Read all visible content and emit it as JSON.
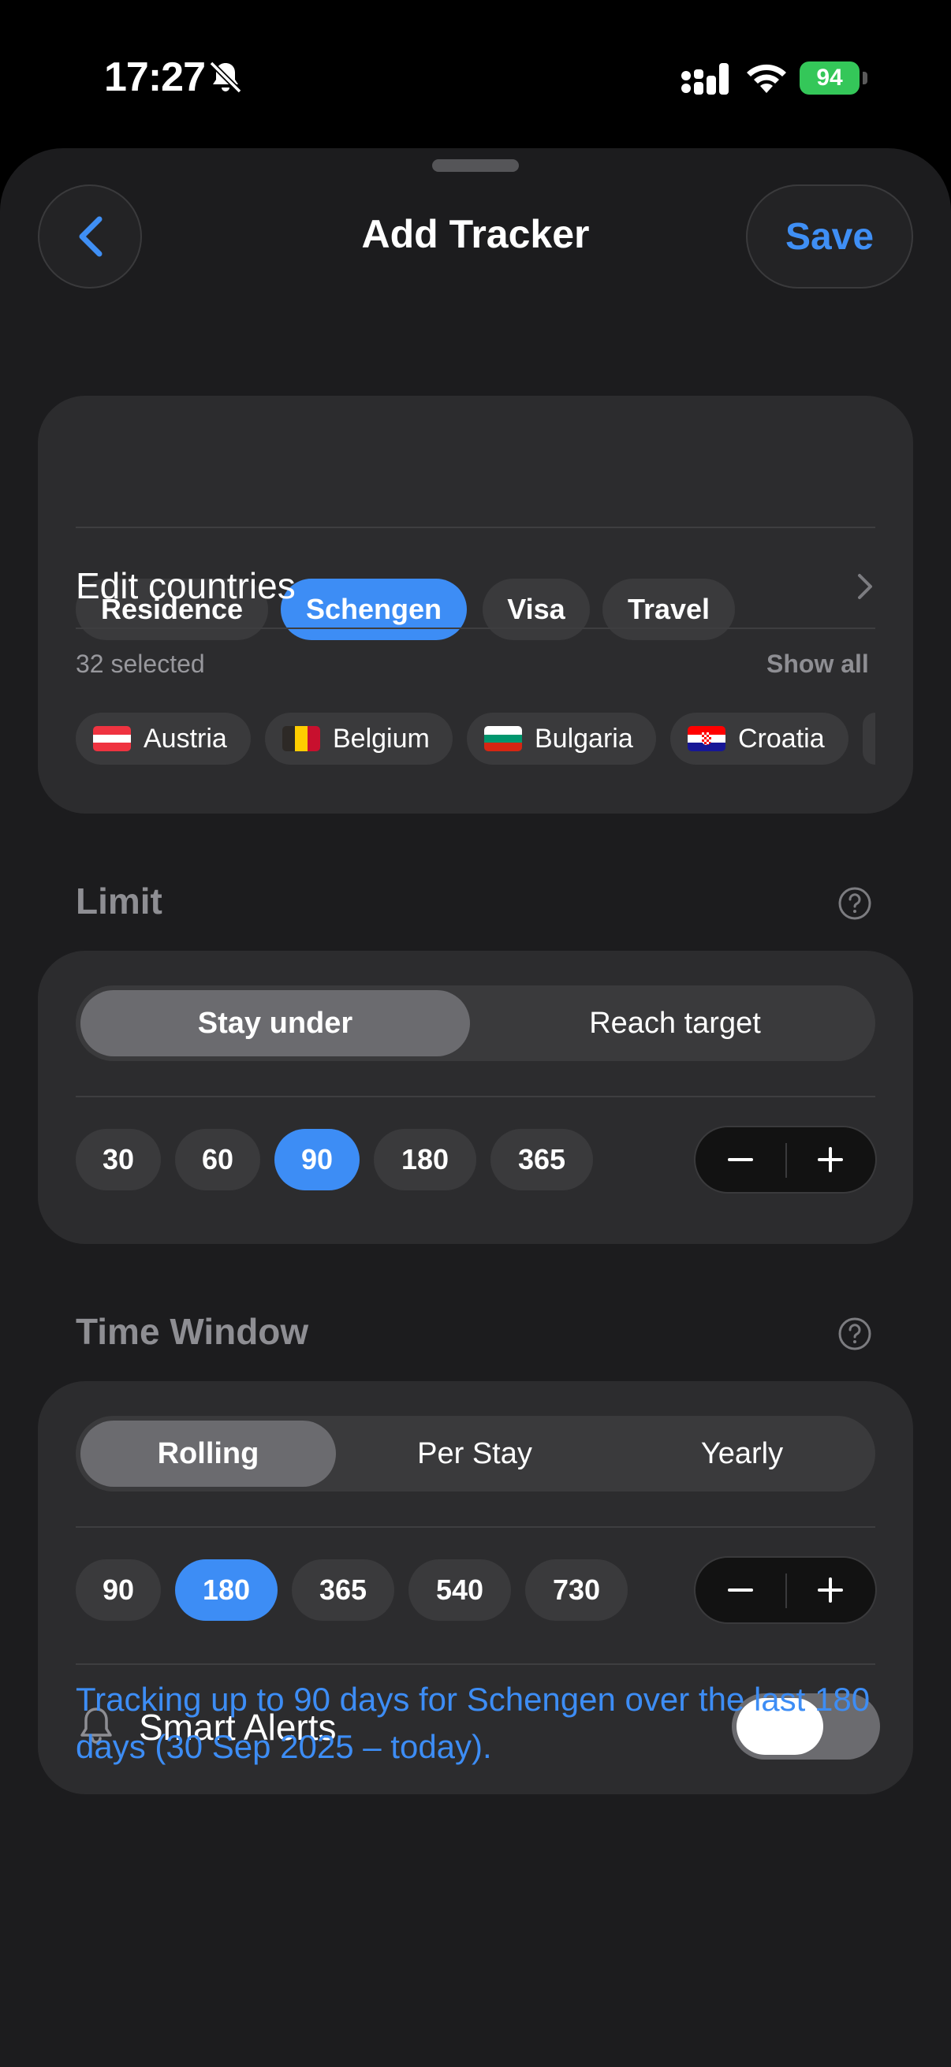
{
  "status_bar": {
    "time": "17:27",
    "battery": "94"
  },
  "header": {
    "title": "Add Tracker",
    "save_label": "Save"
  },
  "tracker_types": [
    {
      "label": "Residence",
      "selected": false
    },
    {
      "label": "Schengen",
      "selected": true
    },
    {
      "label": "Visa",
      "selected": false
    },
    {
      "label": "Travel",
      "selected": false
    }
  ],
  "countries": {
    "edit_label": "Edit countries",
    "selected_count": "32 selected",
    "show_all": "Show all",
    "items": [
      {
        "name": "Austria",
        "flag": [
          "#ef3340",
          "#ffffff",
          "#ef3340"
        ]
      },
      {
        "name": "Belgium",
        "flag": [
          "#2d2926",
          "#ffcd00",
          "#c8102e"
        ]
      },
      {
        "name": "Bulgaria",
        "flag": [
          "#ffffff",
          "#00966e",
          "#d62612"
        ]
      },
      {
        "name": "Croatia",
        "flag": [
          "#ff0000",
          "#ffffff",
          "#171796"
        ]
      }
    ]
  },
  "limit": {
    "title": "Limit",
    "modes": [
      {
        "label": "Stay under",
        "selected": true
      },
      {
        "label": "Reach target",
        "selected": false
      }
    ],
    "presets": [
      {
        "label": "30",
        "selected": false
      },
      {
        "label": "60",
        "selected": false
      },
      {
        "label": "90",
        "selected": true
      },
      {
        "label": "180",
        "selected": false
      },
      {
        "label": "365",
        "selected": false
      }
    ]
  },
  "time_window": {
    "title": "Time Window",
    "modes": [
      {
        "label": "Rolling",
        "selected": true
      },
      {
        "label": "Per Stay",
        "selected": false
      },
      {
        "label": "Yearly",
        "selected": false
      }
    ],
    "presets": [
      {
        "label": "90",
        "selected": false
      },
      {
        "label": "180",
        "selected": true
      },
      {
        "label": "365",
        "selected": false
      },
      {
        "label": "540",
        "selected": false
      },
      {
        "label": "730",
        "selected": false
      }
    ],
    "smart_alerts_label": "Smart Alerts",
    "smart_alerts_on": false
  },
  "summary": "Tracking up to 90 days for Schengen over the last 180 days (30 Sep 2025 – today).",
  "colors": {
    "accent": "#3d8df5",
    "background": "#1c1c1e",
    "card": "#2c2c2e",
    "chip": "#3a3a3c"
  }
}
